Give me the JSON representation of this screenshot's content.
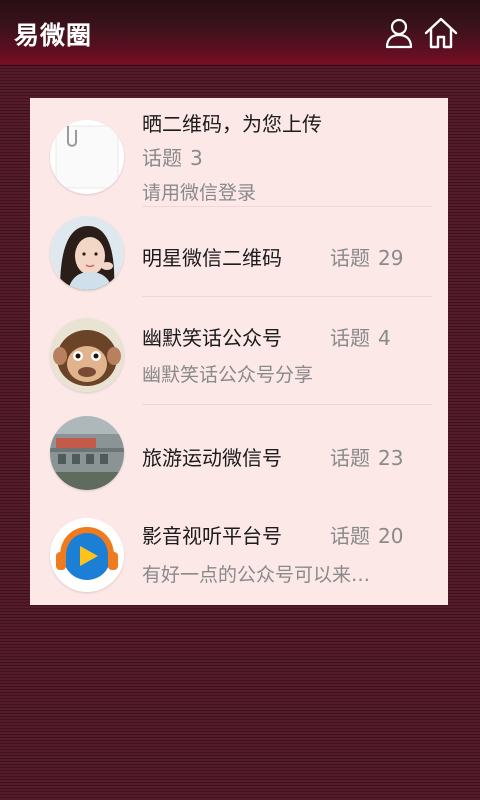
{
  "header": {
    "title": "易微圈",
    "icons": [
      "user-icon",
      "home-icon"
    ]
  },
  "list": [
    {
      "title": "晒二维码，为您上传",
      "topic_label": "话题",
      "topic_count": "3",
      "subtitle": "请用微信登录",
      "avatar": "paperclip-note"
    },
    {
      "title": "明星微信二维码",
      "topic_label": "话题",
      "topic_count": "29",
      "subtitle": "",
      "avatar": "woman-photo"
    },
    {
      "title": "幽默笑话公众号",
      "topic_label": "话题",
      "topic_count": "4",
      "subtitle": "幽默笑话公众号分享",
      "avatar": "monkey-photo"
    },
    {
      "title": "旅游运动微信号",
      "topic_label": "话题",
      "topic_count": "23",
      "subtitle": "",
      "avatar": "building-photo"
    },
    {
      "title": "影音视听平台号",
      "topic_label": "话题",
      "topic_count": "20",
      "subtitle": "有好一点的公众号可以来…",
      "avatar": "media-player-logo"
    }
  ]
}
